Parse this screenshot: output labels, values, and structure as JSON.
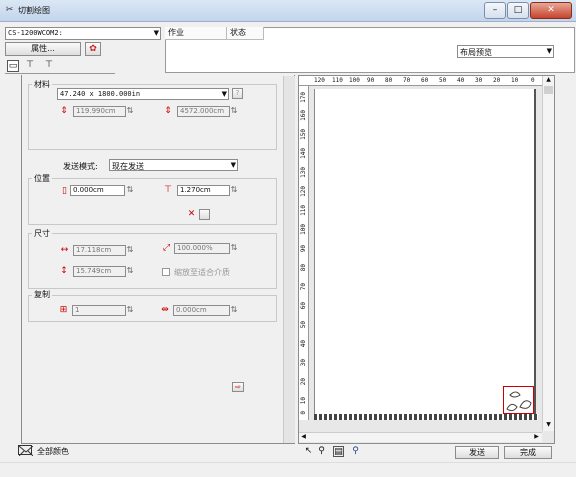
{
  "window": {
    "title": "切割绘图"
  },
  "device": {
    "selected": "CS-1200WCOM2:"
  },
  "props": {
    "label": "属性..."
  },
  "jobs": {
    "col_job": "作业",
    "col_status": "状态"
  },
  "layout": {
    "selected": "布局预览"
  },
  "material": {
    "group_label": "材料",
    "size": "47.240 x 1800.000in",
    "width": "119.990cm",
    "length": "4572.000cm"
  },
  "send_mode": {
    "label": "发送模式:",
    "value": "现在发送"
  },
  "position": {
    "group_label": "位置",
    "x": "0.000cm",
    "y": "1.270cm"
  },
  "size": {
    "group_label": "尺寸",
    "width": "17.118cm",
    "height": "15.749cm",
    "scale": "100.000%",
    "fit_label": "缩放至适合介质"
  },
  "copy": {
    "group_label": "复制",
    "count": "1",
    "spacing": "0.000cm"
  },
  "ruler": {
    "h_ticks": [
      "120",
      "110",
      "100",
      "90",
      "80",
      "70",
      "60",
      "50",
      "40",
      "30",
      "20",
      "10",
      "0"
    ],
    "v_ticks": [
      "170",
      "160",
      "150",
      "140",
      "130",
      "120",
      "110",
      "100",
      "90",
      "80",
      "70",
      "60",
      "50",
      "40",
      "30",
      "20",
      "10",
      "0"
    ]
  },
  "status": {
    "all_colors": "全部颜色"
  },
  "footer": {
    "send": "发送",
    "done": "完成"
  }
}
